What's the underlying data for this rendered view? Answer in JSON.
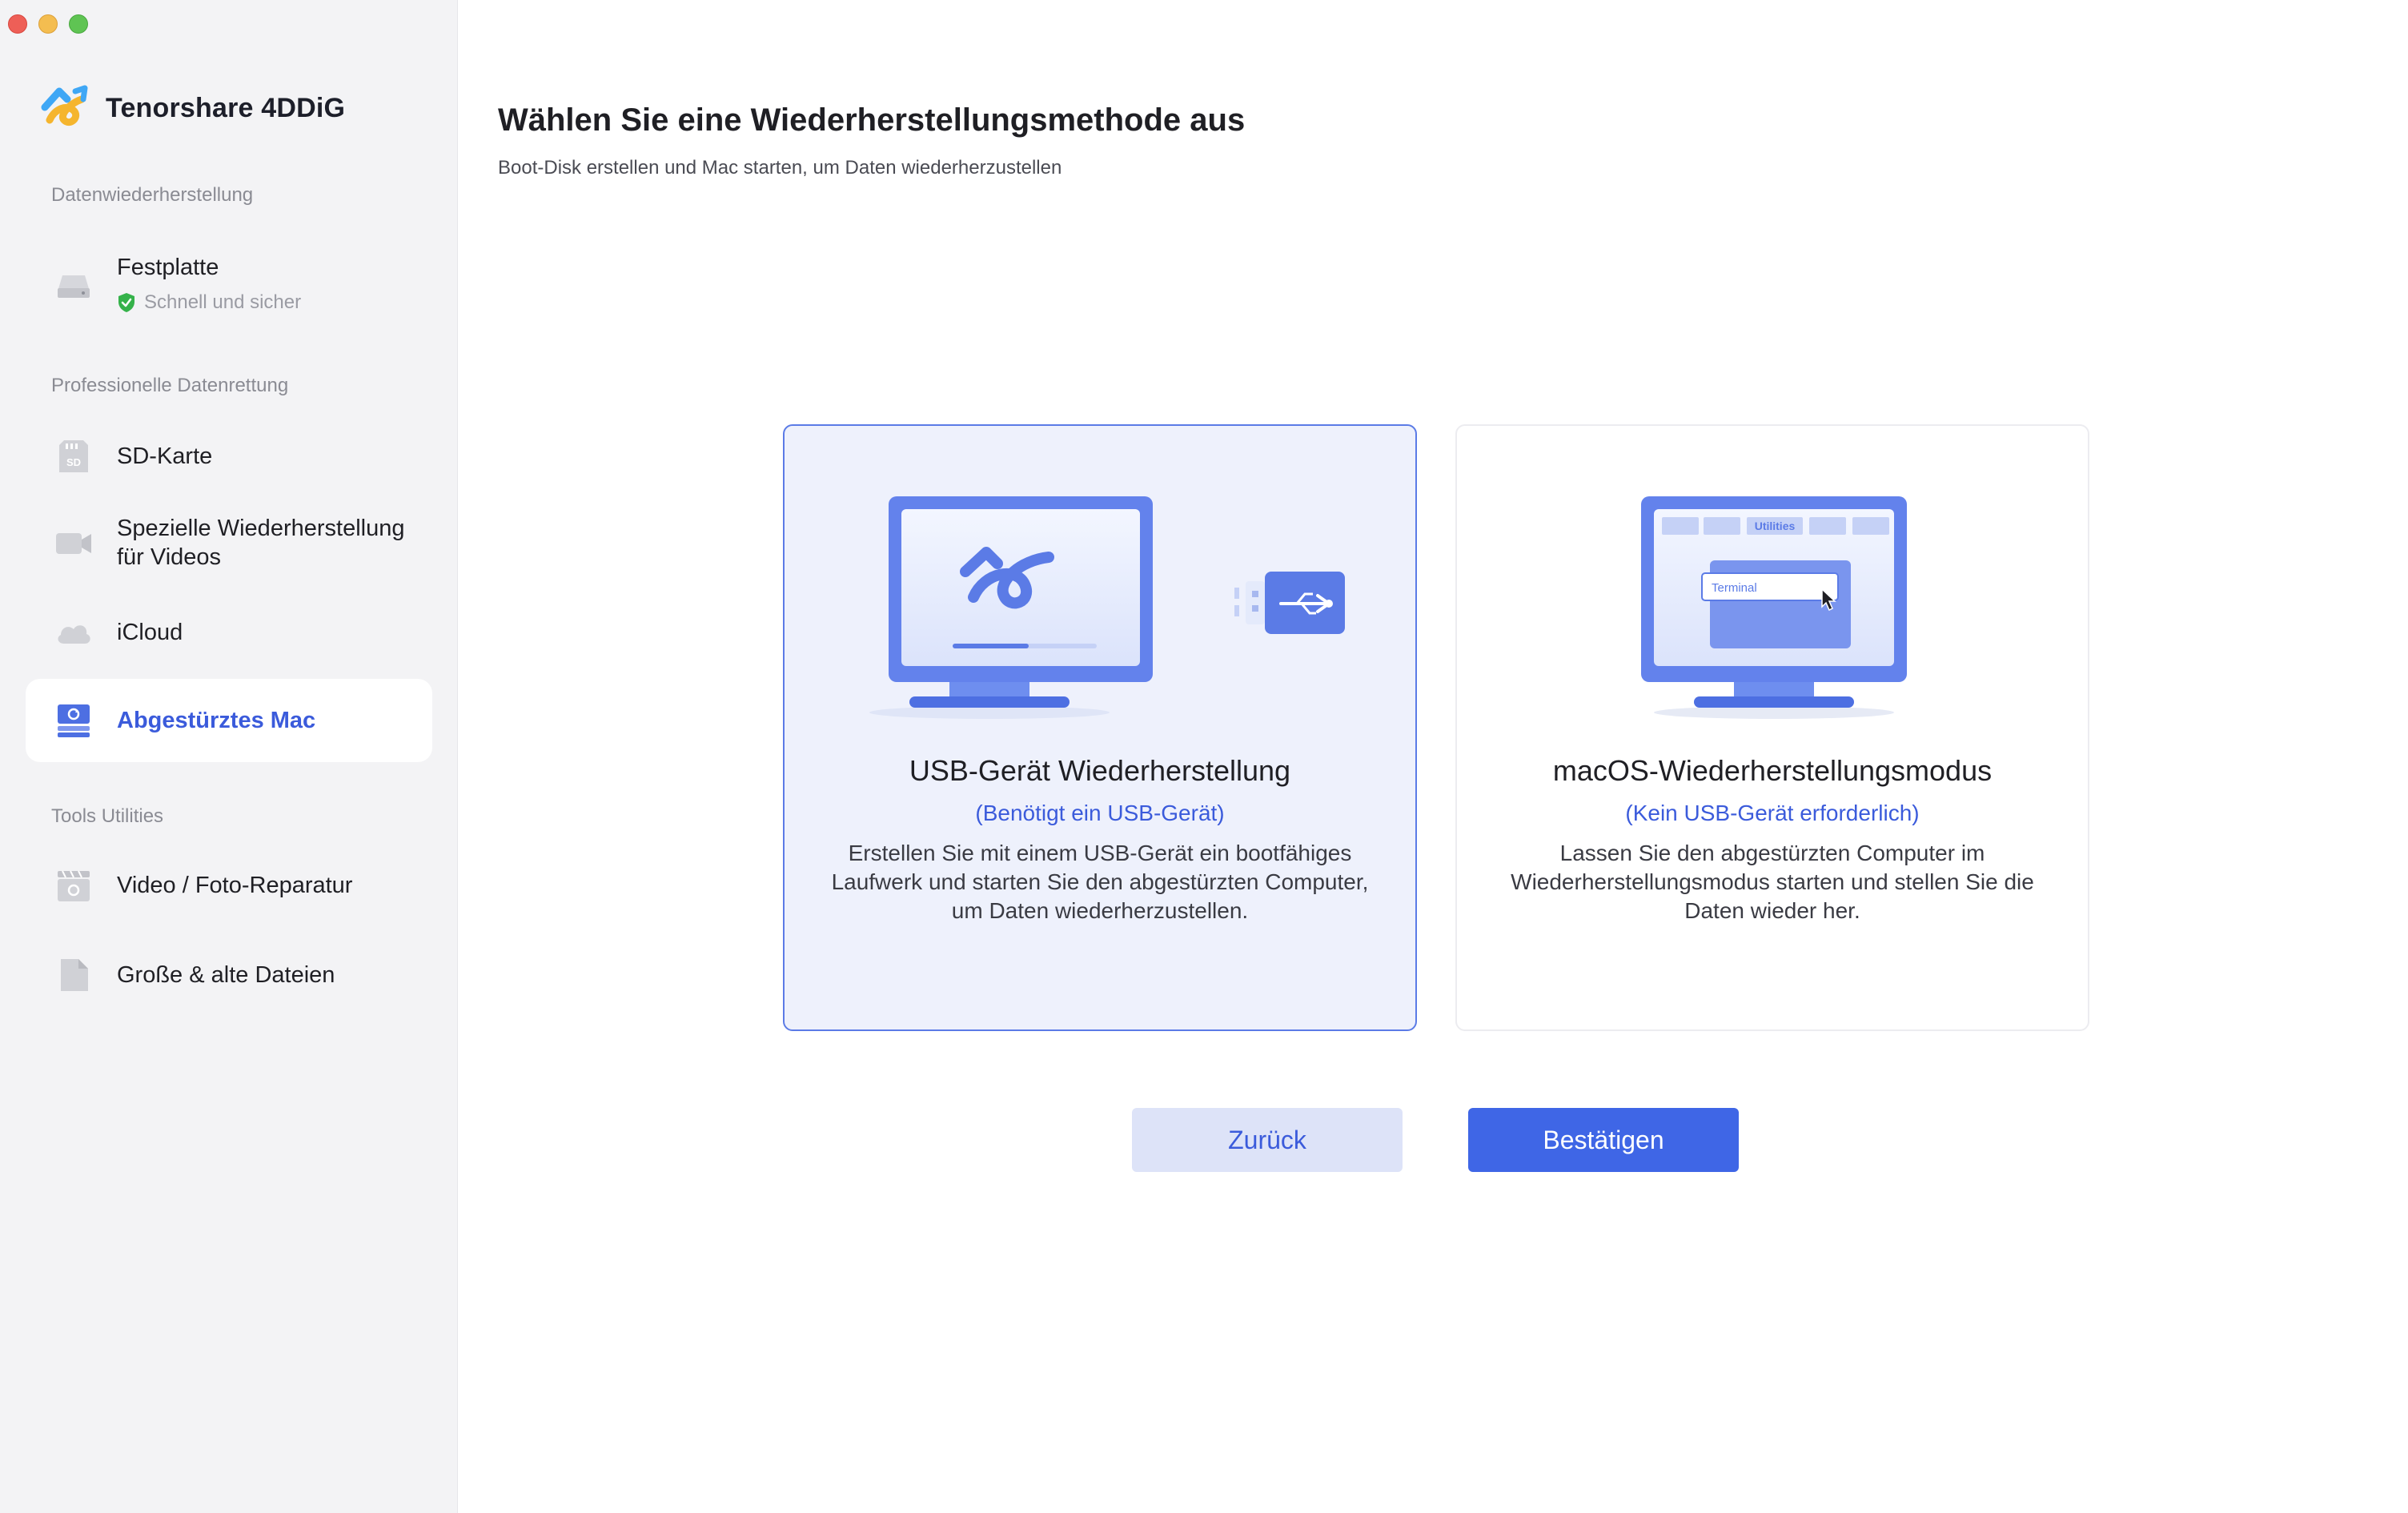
{
  "app": {
    "name": "Tenorshare 4DDiG"
  },
  "sidebar": {
    "sections": [
      {
        "label": "Datenwiederherstellung"
      },
      {
        "label": "Professionelle Datenrettung"
      },
      {
        "label": "Tools  Utilities"
      }
    ],
    "items": [
      {
        "label": "Festplatte",
        "sub": "Schnell und sicher",
        "icon": "hard-drive-icon"
      },
      {
        "label": "SD-Karte",
        "icon": "sd-card-icon"
      },
      {
        "label": "Spezielle Wiederherstellung für Videos",
        "icon": "video-camera-icon"
      },
      {
        "label": "iCloud",
        "icon": "cloud-icon"
      },
      {
        "label": "Abgestürztes Mac",
        "icon": "crashed-mac-icon",
        "active": true
      },
      {
        "label": "Video / Foto-Reparatur",
        "icon": "clapperboard-icon"
      },
      {
        "label": "Große & alte Dateien",
        "icon": "file-icon"
      }
    ]
  },
  "main": {
    "title": "Wählen Sie eine Wiederherstellungsmethode aus",
    "subtitle": "Boot-Disk erstellen und Mac starten, um Daten wiederherzustellen",
    "cards": [
      {
        "title": "USB-Gerät Wiederherstellung",
        "note": "(Benötigt ein USB-Gerät)",
        "description": "Erstellen Sie mit einem USB-Gerät ein bootfähiges Laufwerk und starten Sie den abgestürzten Computer, um Daten wiederherzustellen.",
        "selected": true
      },
      {
        "title": "macOS-Wiederherstellungsmodus",
        "note": "(Kein USB-Gerät erforderlich)",
        "description": "Lassen Sie den abgestürzten Computer im Wiederherstellungsmodus starten und stellen Sie die Daten wieder her.",
        "illustration": {
          "window_title": "Utilities",
          "menu_item": "Terminal"
        }
      }
    ],
    "buttons": {
      "back": "Zurück",
      "confirm": "Bestätigen"
    }
  },
  "colors": {
    "accent": "#3f66e6",
    "accent_text": "#3b5bdb",
    "sidebar_bg": "#f3f3f5",
    "selected_card_bg": "#eef1fc",
    "secondary_button_bg": "#dde3f8"
  }
}
